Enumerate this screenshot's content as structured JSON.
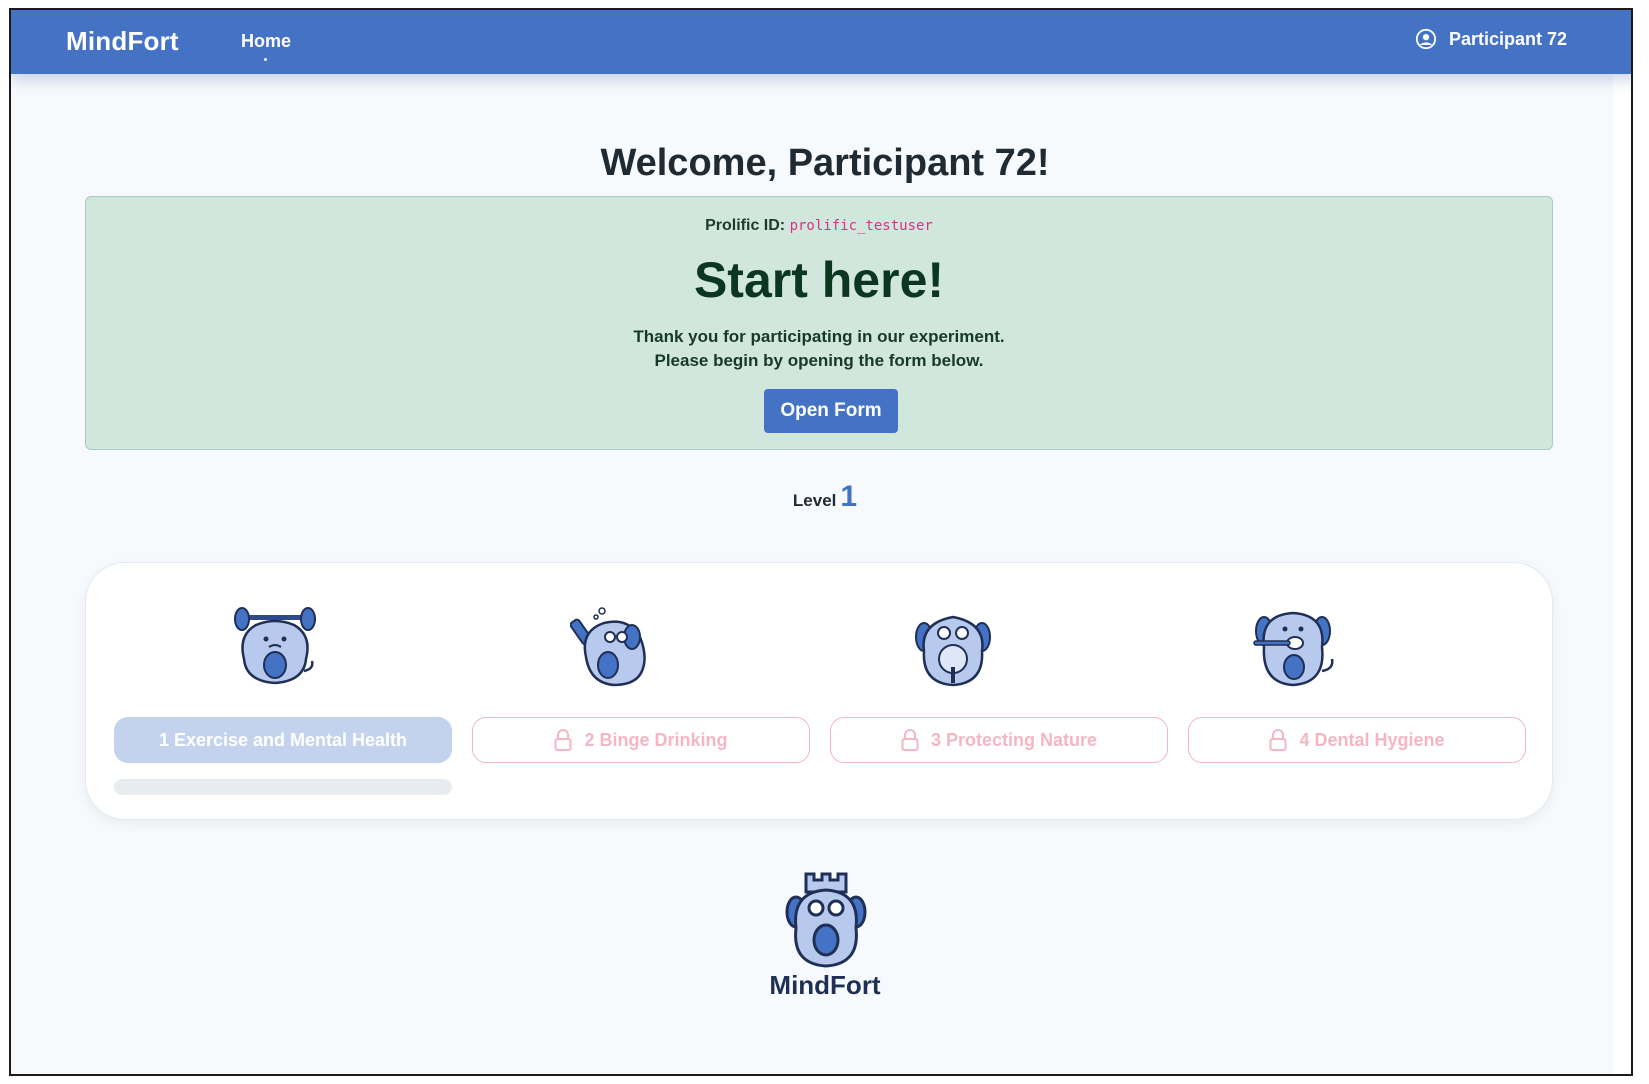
{
  "navbar": {
    "brand": "MindFort",
    "home_label": "Home",
    "user_label": "Participant 72"
  },
  "welcome": "Welcome, Participant 72!",
  "start_card": {
    "prolific_label": "Prolific ID:",
    "prolific_id": "prolific_testuser",
    "title": "Start here!",
    "line1": "Thank you for participating in our experiment.",
    "line2": "Please begin by opening the form below.",
    "button_label": "Open Form"
  },
  "level": {
    "label": "Level",
    "value": "1"
  },
  "modules": [
    {
      "label": "1 Exercise and Mental Health",
      "locked": false,
      "mascot": "dog-lifting-weights-icon",
      "progress": 0
    },
    {
      "label": "2 Binge Drinking",
      "locked": true,
      "mascot": "dog-drinking-bottle-icon"
    },
    {
      "label": "3 Protecting Nature",
      "locked": true,
      "mascot": "dog-holding-tree-icon"
    },
    {
      "label": "4 Dental Hygiene",
      "locked": true,
      "mascot": "dog-brushing-teeth-icon"
    }
  ],
  "footer": {
    "name": "MindFort",
    "logo": "mindfort-dog-tower-logo"
  },
  "colors": {
    "primary": "#4472c4",
    "success_bg": "#d1e7dd",
    "locked": "#f4b6c2",
    "code": "#d63384"
  }
}
